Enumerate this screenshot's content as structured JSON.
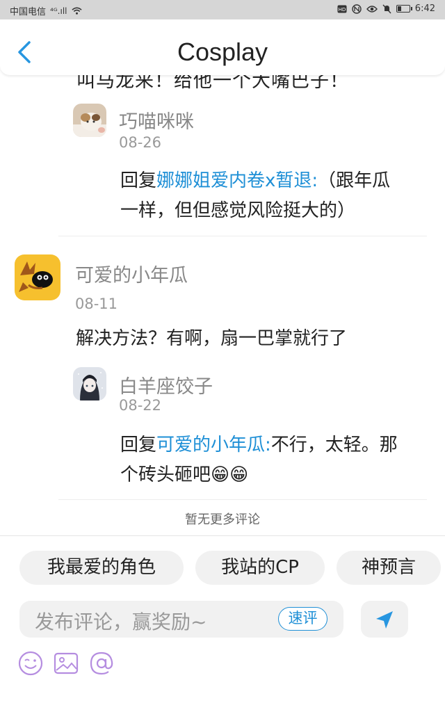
{
  "status_bar": {
    "carrier": "中国电信",
    "signal": "⁴ᴳ.ıll",
    "time": "6:42"
  },
  "nav": {
    "title": "Cosplay"
  },
  "comments": {
    "partial_text": "叫马龙来！给他一个大嘴巴子！",
    "reply1": {
      "name": "巧喵咪咪",
      "date": "08-26",
      "prefix": "回复",
      "mention": "娜娜姐爱内卷x暂退:",
      "text_line1": "（跟年瓜",
      "text_line2": "一样，但但感觉风险挺大的）"
    },
    "main": {
      "name": "可爱的小年瓜",
      "date": "08-11",
      "text": "解决方法？有啊，扇一巴掌就行了"
    },
    "reply2": {
      "name": "白羊座饺子",
      "date": "08-22",
      "prefix": "回复",
      "mention": "可爱的小年瓜:",
      "text_line1": "不行，太轻。那",
      "text_line2": "个砖头砸吧😁😁"
    },
    "no_more": "暂无更多评论"
  },
  "quick_tags": [
    "我最爱的角色",
    "我站的CP",
    "神预言"
  ],
  "comment_input": {
    "placeholder": "发布评论，赢奖励~",
    "quick_label": "速评"
  },
  "colors": {
    "accent": "#1e8fd6",
    "tool_icon": "#b58de0"
  },
  "icons": {
    "back": "chevron-left",
    "send": "paper-plane",
    "emoji": "smile-face",
    "image": "picture",
    "mention": "at-sign"
  }
}
